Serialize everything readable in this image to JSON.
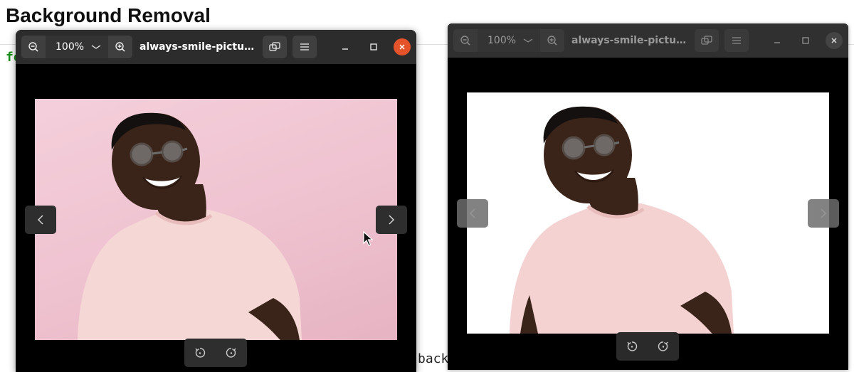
{
  "page": {
    "title": "Background Removal",
    "code_left_fragment": "fo",
    "code_bottom_fragment": "back"
  },
  "viewer_left": {
    "zoom_level": "100%",
    "title": "always-smile-pictu...",
    "state": "active",
    "image_background": "pink"
  },
  "viewer_right": {
    "zoom_level": "100%",
    "title": "always-smile-pictu...",
    "state": "inactive",
    "image_background": "white"
  },
  "colors": {
    "title_bar": "#2c2c2c",
    "close_active": "#e5532b",
    "pink_bg": "#f2c9d6",
    "code_green": "#1a8f1a"
  },
  "icons": [
    "zoom-out-icon",
    "zoom-in-icon",
    "chevron-down-icon",
    "fit-window-icon",
    "menu-icon",
    "minimize-icon",
    "maximize-icon",
    "close-icon",
    "arrow-left-icon",
    "arrow-right-icon",
    "rotate-left-icon",
    "rotate-right-icon",
    "cursor-icon"
  ]
}
